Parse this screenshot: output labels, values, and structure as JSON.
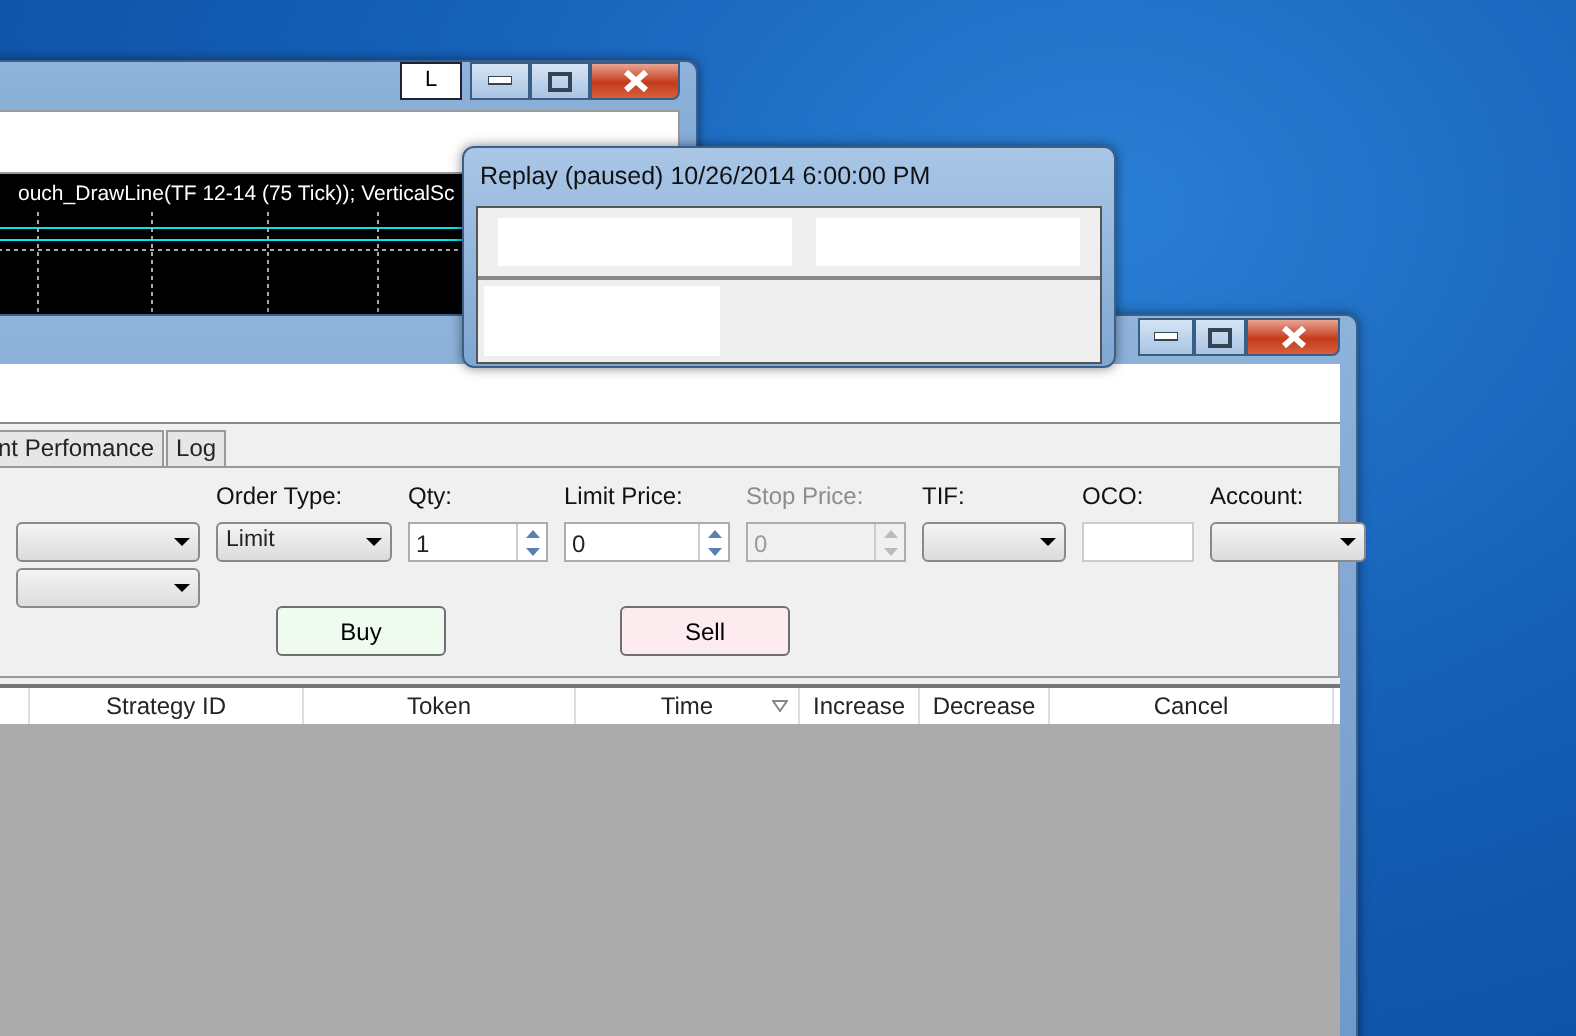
{
  "chart_window": {
    "title_button": "L",
    "chart_text": "ouch_DrawLine(TF 12-14 (75 Tick)); VerticalSc"
  },
  "replay_window": {
    "title": "Replay (paused) 10/26/2014 6:00:00 PM"
  },
  "order_window": {
    "tabs": [
      {
        "label": "nt Perfomance",
        "selected": false
      },
      {
        "label": "Log",
        "selected": false
      }
    ],
    "fields": [
      {
        "kind": "combo",
        "label": "Order Type:",
        "value": "Limit",
        "disabled": false
      },
      {
        "kind": "spin",
        "label": "Qty:",
        "value": "1",
        "disabled": false
      },
      {
        "kind": "spin",
        "label": "Limit Price:",
        "value": "0",
        "disabled": false
      },
      {
        "kind": "spin",
        "label": "Stop Price:",
        "value": "0",
        "disabled": true
      },
      {
        "kind": "combo",
        "label": "TIF:",
        "disabled": false
      },
      {
        "kind": "text",
        "label": "OCO:",
        "disabled": false
      },
      {
        "kind": "combo",
        "label": "Account:",
        "disabled": false
      }
    ],
    "buttons": [
      {
        "kind": "buy",
        "label": "Buy"
      },
      {
        "kind": "sell",
        "label": "Sell"
      }
    ],
    "columns": [
      {
        "label": "Strategy ID",
        "sorted": false
      },
      {
        "label": "Token",
        "sorted": false
      },
      {
        "label": "Time",
        "sorted": true
      },
      {
        "label": "Increase",
        "sorted": false
      },
      {
        "label": "Decrease",
        "sorted": false
      },
      {
        "label": "Cancel",
        "sorted": false
      }
    ]
  }
}
